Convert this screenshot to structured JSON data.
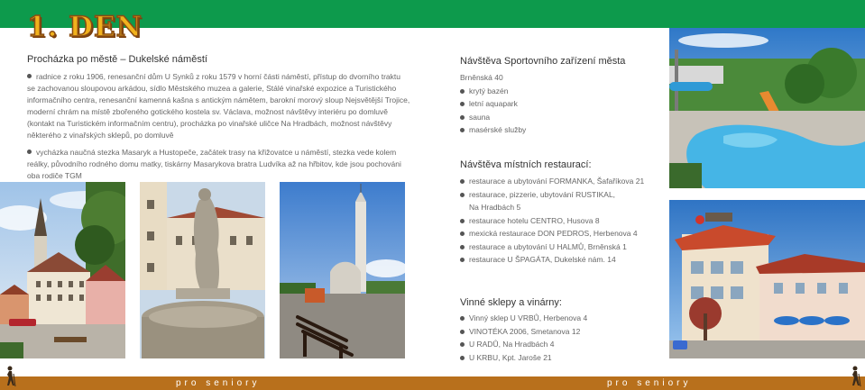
{
  "heading": "1. DEN",
  "left": {
    "title": "Procházka po městě – Dukelské náměstí",
    "p1": "radnice z roku 1906, renesanční dům U Synků z roku 1579 v horní části náměstí, přístup do dvorního traktu se zachovanou sloupovou arkádou, sídlo Městského muzea a galerie, Stálé vinařské expozice a Turistického informačního centra, renesanční kamenná kašna s antickým námětem, barokní morový sloup Nejsvětější Trojice, moderní chrám na místě zbořeného gotického kostela sv. Václava, možnost návštěvy interiéru po domluvě (kontakt na Turistickém informačním centru), procházka po vinařské uličce Na Hradbách, možnost návštěvy některého z vinařských sklepů, po domluvě",
    "p2": "vycházka naučná stezka Masaryk a Hustopeče, začátek trasy na křižovatce u náměstí, stezka vede kolem reálky, původního rodného domu matky, tiskárny Masarykova bratra Ludvíka až na hřbitov, kde jsou pochováni oba rodiče TGM"
  },
  "sport": {
    "title": "Návštěva Sportovního zařízení města",
    "address": "Brněnská 40",
    "items": [
      "krytý bazén",
      "letní aquapark",
      "sauna",
      "masérské služby"
    ]
  },
  "restaurants": {
    "title": "Návštěva místních restaurací:",
    "items": [
      "restaurace a ubytování FORMANKA, Šafaříkova 21",
      "restaurace, pizzerie, ubytování RUSTIKAL,",
      "restaurace hotelu CENTRO, Husova 8",
      "mexická restaurace DON PEDROS, Herbenova 4",
      "restaurace a ubytování U HALMŮ, Brněnská 1",
      "restaurace U ŠPAGÁTA, Dukelské nám. 14"
    ],
    "item2_sub": "Na Hradbách 5"
  },
  "wine": {
    "title": "Vinné sklepy a vinárny:",
    "items": [
      "Vinný sklep U VRBŮ, Herbenova 4",
      "VINOTÉKA 2006, Smetanova 12",
      "U RADŮ, Na Hradbách 4",
      "U KRBU, Kpt. Jaroše 21"
    ]
  },
  "footer": {
    "left": "pro seniory",
    "right": "pro seniory"
  },
  "colors": {
    "green_bar": "#0d9a4c",
    "brown_bar": "#b8701c",
    "heading_yellow": "#f1b21d",
    "left_panel": "#ffffff"
  }
}
